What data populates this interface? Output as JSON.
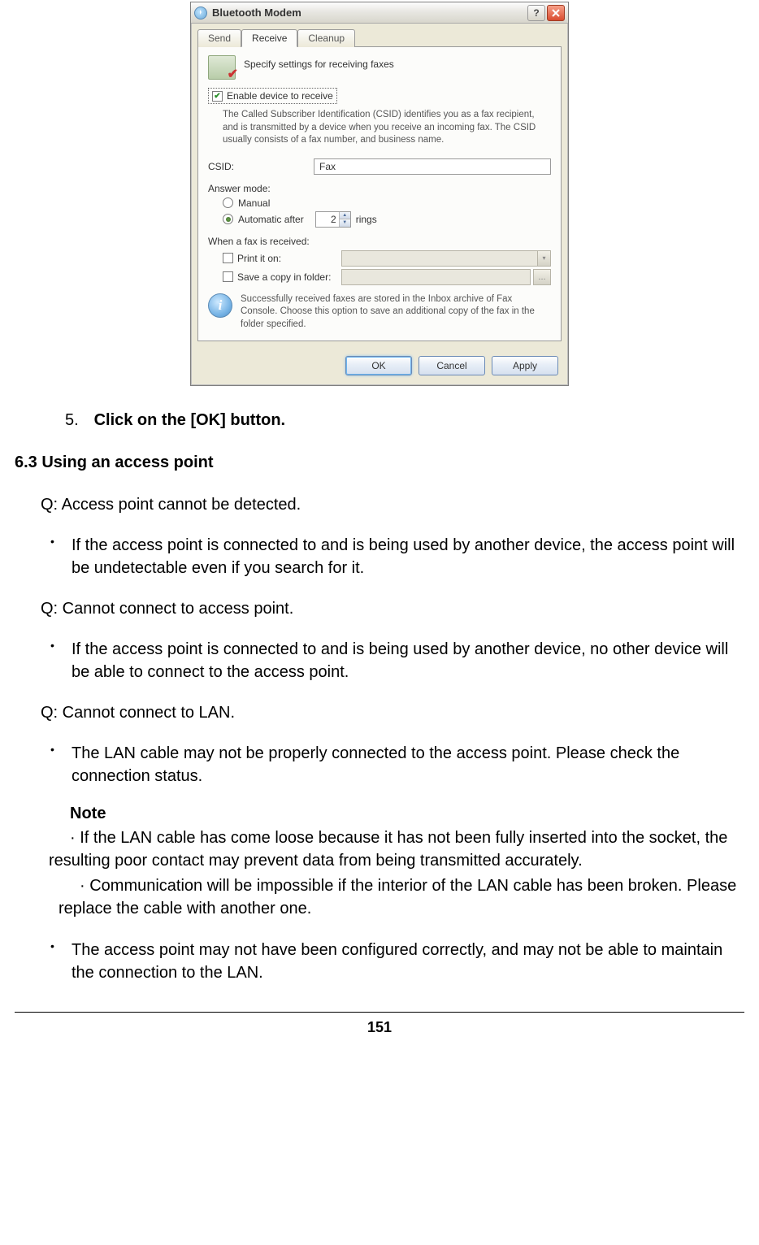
{
  "dialog": {
    "title": "Bluetooth Modem",
    "help_symbol": "?",
    "tabs": {
      "send": "Send",
      "receive": "Receive",
      "cleanup": "Cleanup"
    },
    "header": "Specify settings for receiving faxes",
    "enable_label": "Enable device to receive",
    "csid_info": "The Called Subscriber Identification (CSID) identifies you as a fax recipient, and is transmitted by a device when you receive an incoming fax. The CSID usually consists of a fax number, and business name.",
    "csid_label": "CSID:",
    "csid_value": "Fax",
    "answer_mode_label": "Answer mode:",
    "manual_label": "Manual",
    "auto_label": "Automatic after",
    "rings_value": "2",
    "rings_label": "rings",
    "when_received_label": "When a fax is received:",
    "print_label": "Print it on:",
    "save_label": "Save a copy in folder:",
    "browse_label": "...",
    "info_note": "Successfully received faxes are stored in the Inbox archive of Fax Console. Choose this option to save an additional copy of the fax in the folder specified.",
    "ok": "OK",
    "cancel": "Cancel",
    "apply": "Apply"
  },
  "doc": {
    "step5_num": "5.",
    "step5": "Click on the [OK] button.",
    "section": "6.3  Using an access point",
    "q1": "Q: Access point cannot be detected.",
    "a1": "If the access point is connected to and is being used by another device, the access point will be undetectable even if you search for it.",
    "q2": "Q: Cannot connect to access point.",
    "a2": "If the access point is connected to and is being used by another device, no other device will be able to connect to the access point.",
    "q3": "Q: Cannot connect to LAN.",
    "a3": "The LAN cable may not be properly connected to the access point. Please check the connection status.",
    "note_label": "Note",
    "note1": "· If the LAN cable has come loose because it has not been fully inserted into the      socket, the resulting poor contact may prevent data from being transmitted       accurately.",
    "note2": "· Communication will be impossible if the interior of the LAN cable has been   broken. Please replace the cable with another one.",
    "a4": "The access point may not have been configured correctly, and may not be able to maintain the connection to the LAN.",
    "page": "151"
  }
}
